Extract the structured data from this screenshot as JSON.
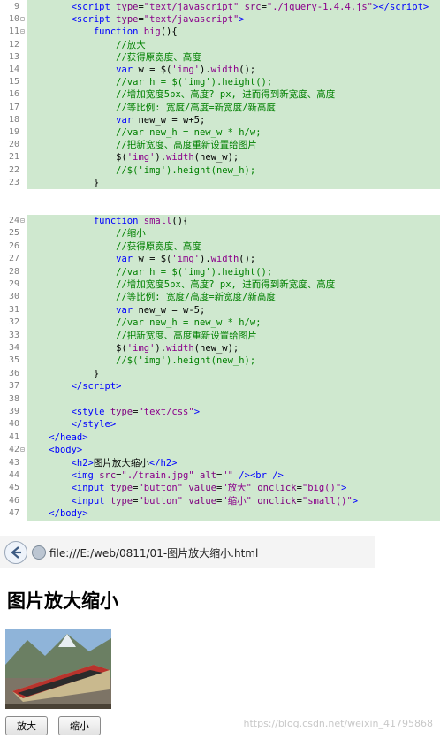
{
  "code_top": {
    "lines": [
      {
        "n": "9",
        "fold": "",
        "html": "<span class=\"kw\">&lt;script</span> <span class=\"at\">type</span>=<span class=\"fn\">\"text/javascript\"</span> <span class=\"at\">src</span>=<span class=\"fn\">\"./jquery-1.4.4.js\"</span><span class=\"kw\">&gt;&lt;/script&gt;</span>",
        "indent": "        "
      },
      {
        "n": "10",
        "fold": "⊟",
        "html": "<span class=\"kw\">&lt;script</span> <span class=\"at\">type</span>=<span class=\"fn\">\"text/javascript\"</span><span class=\"kw\">&gt;</span>",
        "indent": "        "
      },
      {
        "n": "11",
        "fold": "⊟",
        "html": "<span class=\"kw\">function</span> <span class=\"fn\">big</span>(){",
        "indent": "            "
      },
      {
        "n": "12",
        "fold": "",
        "html": "<span class=\"cm\">//放大</span>",
        "indent": "                "
      },
      {
        "n": "13",
        "fold": "",
        "html": "<span class=\"cm\">//获得原宽度、高度</span>",
        "indent": "                "
      },
      {
        "n": "14",
        "fold": "",
        "html": "<span class=\"kw\">var</span> w = $(<span class=\"fn\">'img'</span>).<span class=\"fn\">width</span>();",
        "indent": "                "
      },
      {
        "n": "15",
        "fold": "",
        "html": "<span class=\"cm\">//var h = $('img').height();</span>",
        "indent": "                "
      },
      {
        "n": "16",
        "fold": "",
        "html": "<span class=\"cm\">//增加宽度5px、高度? px, 进而得到新宽度、高度</span>",
        "indent": "                "
      },
      {
        "n": "17",
        "fold": "",
        "html": "<span class=\"cm\">//等比例: 宽度/高度=新宽度/新高度</span>",
        "indent": "                "
      },
      {
        "n": "18",
        "fold": "",
        "html": "<span class=\"kw\">var</span> new_w = w+5;",
        "indent": "                "
      },
      {
        "n": "19",
        "fold": "",
        "html": "<span class=\"cm\">//var new_h = new_w * h/w;</span>",
        "indent": "                "
      },
      {
        "n": "20",
        "fold": "",
        "html": "<span class=\"cm\">//把新宽度、高度重新设置给图片</span>",
        "indent": "                "
      },
      {
        "n": "21",
        "fold": "",
        "html": "$(<span class=\"fn\">'img'</span>).<span class=\"fn\">width</span>(new_w);",
        "indent": "                "
      },
      {
        "n": "22",
        "fold": "",
        "html": "<span class=\"cm\">//$('img').height(new_h);</span>",
        "indent": "                "
      },
      {
        "n": "23",
        "fold": "",
        "html": "}",
        "indent": "            "
      }
    ]
  },
  "code_bottom": {
    "lines": [
      {
        "n": "24",
        "fold": "⊟",
        "html": "<span class=\"kw\">function</span> <span class=\"fn\">small</span>(){",
        "indent": "            "
      },
      {
        "n": "25",
        "fold": "",
        "html": "<span class=\"cm\">//缩小</span>",
        "indent": "                "
      },
      {
        "n": "26",
        "fold": "",
        "html": "<span class=\"cm\">//获得原宽度、高度</span>",
        "indent": "                "
      },
      {
        "n": "27",
        "fold": "",
        "html": "<span class=\"kw\">var</span> w = $(<span class=\"fn\">'img'</span>).<span class=\"fn\">width</span>();",
        "indent": "                "
      },
      {
        "n": "28",
        "fold": "",
        "html": "<span class=\"cm\">//var h = $('img').height();</span>",
        "indent": "                "
      },
      {
        "n": "29",
        "fold": "",
        "html": "<span class=\"cm\">//增加宽度5px、高度? px, 进而得到新宽度、高度</span>",
        "indent": "                "
      },
      {
        "n": "30",
        "fold": "",
        "html": "<span class=\"cm\">//等比例: 宽度/高度=新宽度/新高度</span>",
        "indent": "                "
      },
      {
        "n": "31",
        "fold": "",
        "html": "<span class=\"kw\">var</span> new_w = w-5;",
        "indent": "                "
      },
      {
        "n": "32",
        "fold": "",
        "html": "<span class=\"cm\">//var new_h = new_w * h/w;</span>",
        "indent": "                "
      },
      {
        "n": "33",
        "fold": "",
        "html": "<span class=\"cm\">//把新宽度、高度重新设置给图片</span>",
        "indent": "                "
      },
      {
        "n": "34",
        "fold": "",
        "html": "$(<span class=\"fn\">'img'</span>).<span class=\"fn\">width</span>(new_w);",
        "indent": "                "
      },
      {
        "n": "35",
        "fold": "",
        "html": "<span class=\"cm\">//$('img').height(new_h);</span>",
        "indent": "                "
      },
      {
        "n": "36",
        "fold": "",
        "html": "}",
        "indent": "            "
      },
      {
        "n": "37",
        "fold": "",
        "html": "<span class=\"kw\">&lt;/script&gt;</span>",
        "indent": "        "
      },
      {
        "n": "38",
        "fold": "",
        "html": "",
        "indent": ""
      },
      {
        "n": "39",
        "fold": "",
        "html": "<span class=\"kw\">&lt;style</span> <span class=\"at\">type</span>=<span class=\"fn\">\"text/css\"</span><span class=\"kw\">&gt;</span>",
        "indent": "        "
      },
      {
        "n": "40",
        "fold": "",
        "html": "<span class=\"kw\">&lt;/style&gt;</span>",
        "indent": "        "
      },
      {
        "n": "41",
        "fold": "",
        "html": "<span class=\"kw\">&lt;/head&gt;</span>",
        "indent": "    "
      },
      {
        "n": "42",
        "fold": "⊟",
        "html": "<span class=\"kw\">&lt;body&gt;</span>",
        "indent": "    "
      },
      {
        "n": "43",
        "fold": "",
        "html": "<span class=\"kw\">&lt;h2&gt;</span>图片放大缩小<span class=\"kw\">&lt;/h2&gt;</span>",
        "indent": "        "
      },
      {
        "n": "44",
        "fold": "",
        "html": "<span class=\"kw\">&lt;img</span> <span class=\"at\">src</span>=<span class=\"fn\">\"./train.jpg\"</span> <span class=\"at\">alt</span>=<span class=\"fn\">\"\"</span> <span class=\"kw\">/&gt;&lt;br /&gt;</span>",
        "indent": "        "
      },
      {
        "n": "45",
        "fold": "",
        "html": "<span class=\"kw\">&lt;input</span> <span class=\"at\">type</span>=<span class=\"fn\">\"button\"</span> <span class=\"at\">value</span>=<span class=\"fn\">\"放大\"</span> <span class=\"at\">onclick</span>=<span class=\"fn\">\"big()\"</span><span class=\"kw\">&gt;</span>",
        "indent": "        "
      },
      {
        "n": "46",
        "fold": "",
        "html": "<span class=\"kw\">&lt;input</span> <span class=\"at\">type</span>=<span class=\"fn\">\"button\"</span> <span class=\"at\">value</span>=<span class=\"fn\">\"缩小\"</span> <span class=\"at\">onclick</span>=<span class=\"fn\">\"small()\"</span><span class=\"kw\">&gt;</span>",
        "indent": "        "
      },
      {
        "n": "47",
        "fold": "",
        "html": "<span class=\"kw\">&lt;/body&gt;</span>",
        "indent": "    "
      }
    ]
  },
  "browser": {
    "url": "file:///E:/web/0811/01-图片放大缩小.html",
    "heading": "图片放大缩小",
    "btn_big": "放大",
    "btn_small": "缩小",
    "watermark": "https://blog.csdn.net/weixin_41795868"
  },
  "colors": {
    "code_bg": "#cfe8cf",
    "keyword": "#0000ff",
    "string": "#8b008b",
    "comment": "#008000"
  },
  "icons": [
    "back-arrow-icon",
    "page-globe-icon"
  ]
}
